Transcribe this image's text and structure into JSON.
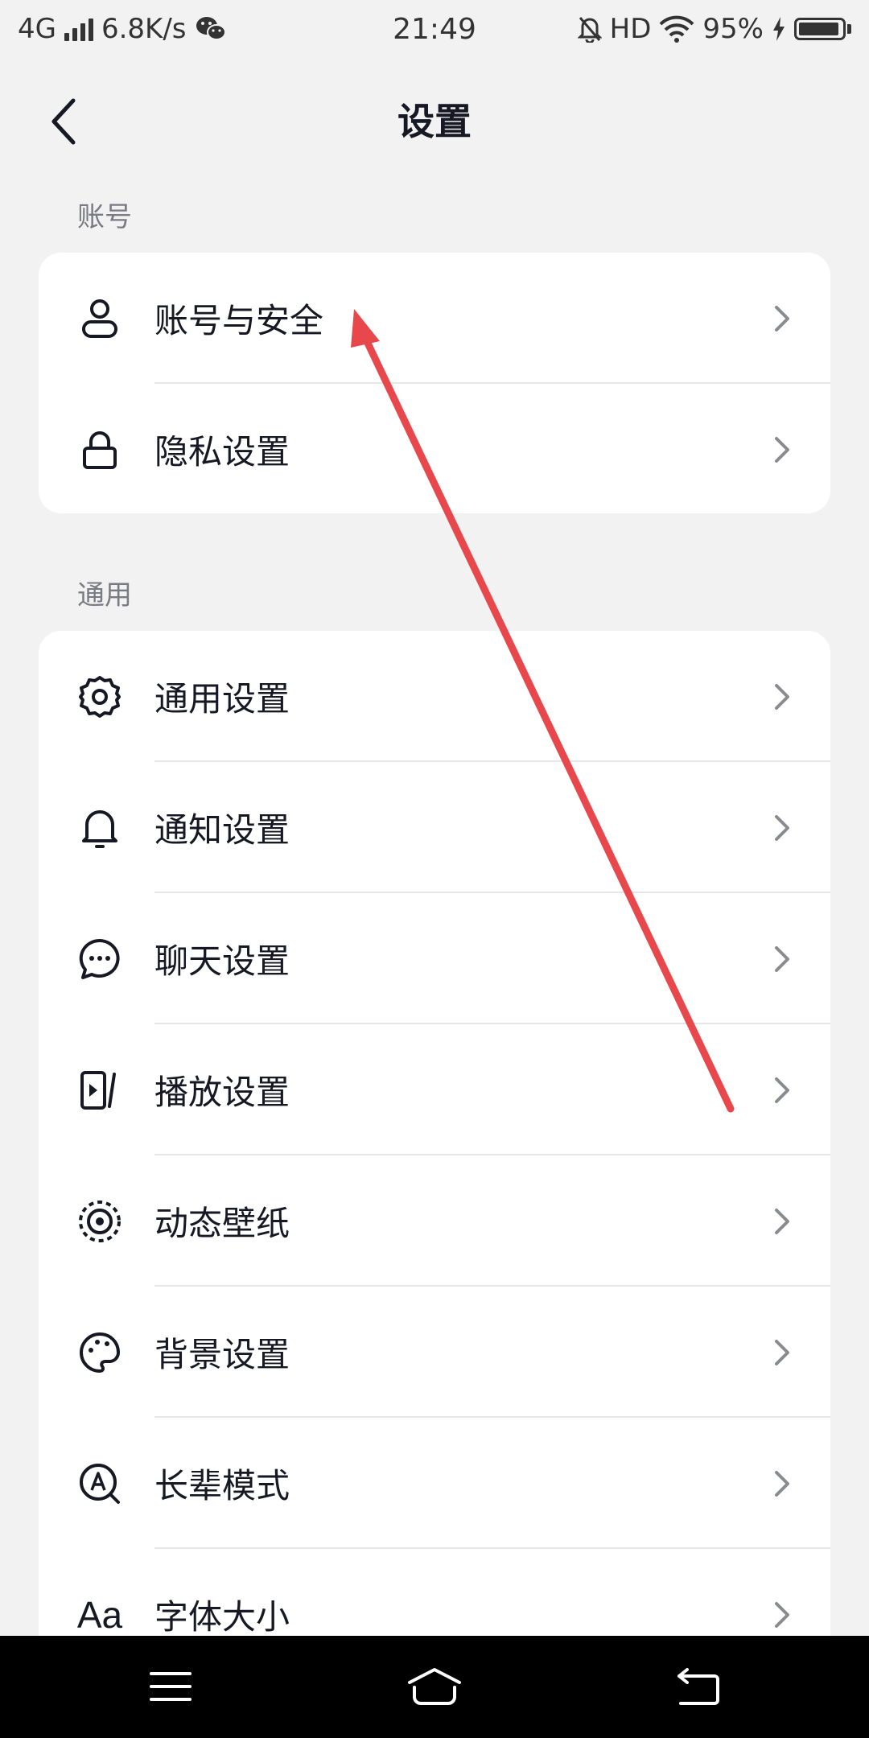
{
  "status_bar": {
    "network": "4G",
    "speed": "6.8K/s",
    "time": "21:49",
    "hd": "HD",
    "battery": "95%",
    "battery_level": 0.95
  },
  "header": {
    "title": "设置",
    "back_icon": "back-arrow-icon"
  },
  "sections": [
    {
      "label": "账号",
      "items": [
        {
          "label": "账号与安全",
          "icon": "user-icon"
        },
        {
          "label": "隐私设置",
          "icon": "lock-icon"
        }
      ]
    },
    {
      "label": "通用",
      "items": [
        {
          "label": "通用设置",
          "icon": "gear-icon"
        },
        {
          "label": "通知设置",
          "icon": "bell-icon"
        },
        {
          "label": "聊天设置",
          "icon": "chat-bubble-icon"
        },
        {
          "label": "播放设置",
          "icon": "play-screen-icon"
        },
        {
          "label": "动态壁纸",
          "icon": "live-wallpaper-icon"
        },
        {
          "label": "背景设置",
          "icon": "palette-icon"
        },
        {
          "label": "长辈模式",
          "icon": "elder-mode-icon"
        },
        {
          "label": "字体大小",
          "icon": "font-size-icon",
          "glyph": "Aa"
        }
      ]
    }
  ],
  "annotation": {
    "color": "#e8474b"
  },
  "nav_bar": {
    "menu_icon": "menu-icon",
    "home_icon": "home-icon",
    "back_icon": "nav-back-icon"
  },
  "colors": {
    "background": "#f2f2f2",
    "card": "#ffffff",
    "text_primary": "#161823",
    "text_secondary": "#7a7b82",
    "chevron": "#8a8b91"
  }
}
